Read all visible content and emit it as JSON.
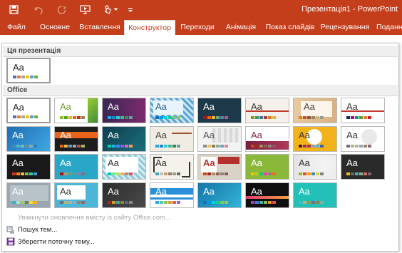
{
  "app": {
    "window_title": "Презентація1 - PowerPoint"
  },
  "quick_access": [
    {
      "name": "save-icon"
    },
    {
      "name": "undo-icon"
    },
    {
      "name": "redo-icon"
    },
    {
      "name": "present-icon"
    },
    {
      "name": "touch-mode-icon"
    },
    {
      "name": "customize-qat-icon"
    }
  ],
  "tabs": [
    "Файл",
    "Основне",
    "Вставлення",
    "Конструктор",
    "Переходи",
    "Анімація",
    "Показ слайдів",
    "Рецензування",
    "Поданн"
  ],
  "active_tab": "Конструктор",
  "gallery": {
    "section_this": "Ця презентація",
    "section_office": "Office",
    "theme_text": "Aa",
    "commands": {
      "enable_updates": "Увімкнути оновлення вмісту із сайту Office.com...",
      "search_themes": "Пошук тем...",
      "save_theme": "Зберегти поточну тему..."
    }
  },
  "colors": {
    "ribbon": "#c43e1c",
    "active_tab_text": "#c43e1c"
  }
}
